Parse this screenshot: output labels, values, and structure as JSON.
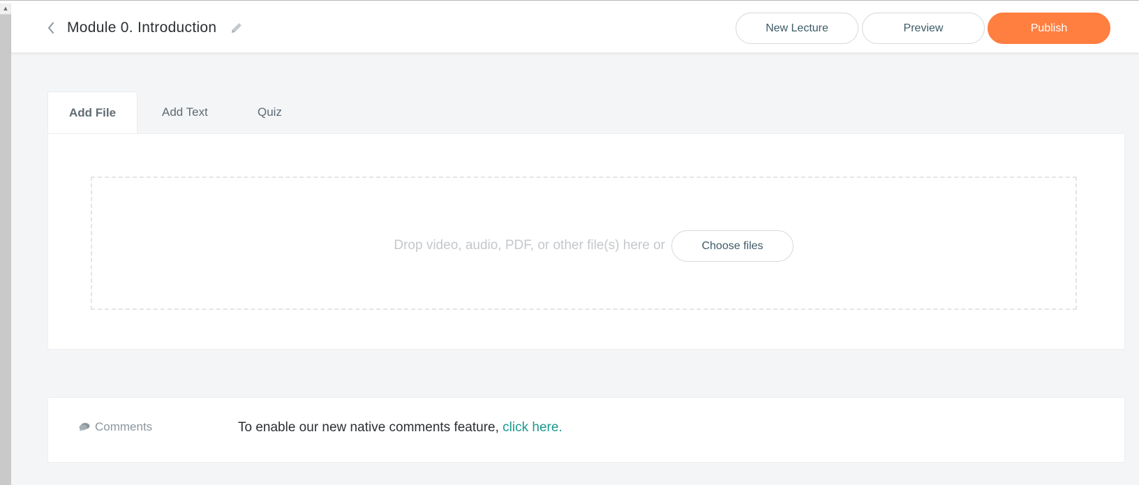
{
  "header": {
    "title": "Module 0. Introduction",
    "new_lecture_label": "New Lecture",
    "preview_label": "Preview",
    "publish_label": "Publish"
  },
  "tabs": [
    {
      "label": "Add File",
      "active": true
    },
    {
      "label": "Add Text",
      "active": false
    },
    {
      "label": "Quiz",
      "active": false
    }
  ],
  "upload": {
    "drop_text": "Drop video, audio, PDF, or other file(s) here or",
    "choose_label": "Choose files"
  },
  "comments": {
    "label": "Comments",
    "message": "To enable our new native comments feature,",
    "link_text": "click here."
  },
  "icons": {
    "back": "chevron-left-icon",
    "edit": "pencil-icon",
    "comments": "comment-bubble-icon",
    "scroll_up": "scroll-up-arrow-icon"
  },
  "colors": {
    "accent": "#ff7f40",
    "link": "#1a9a8f",
    "background": "#f4f5f7"
  }
}
